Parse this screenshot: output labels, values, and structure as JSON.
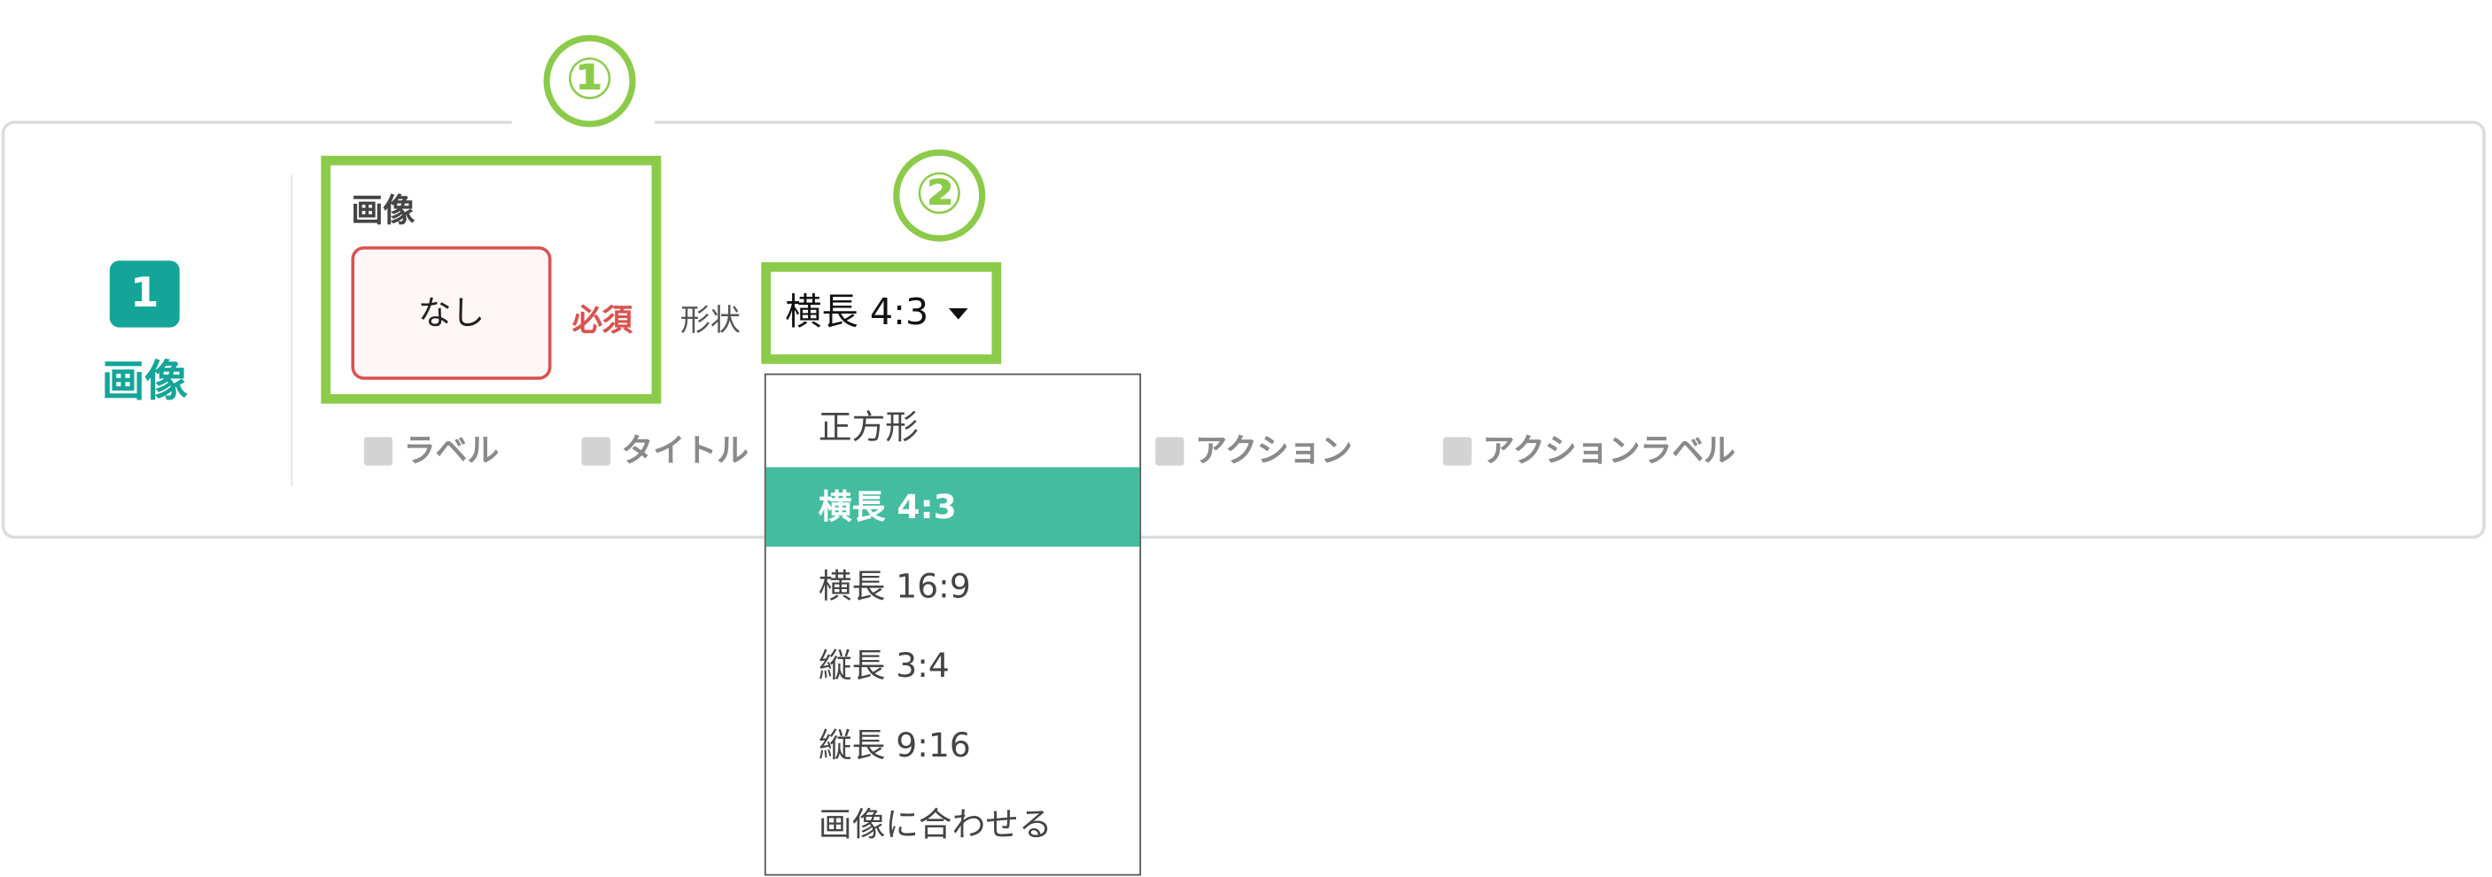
{
  "callouts": {
    "one": "①",
    "two": "②"
  },
  "step": {
    "number": "1",
    "label": "画像"
  },
  "image_field": {
    "title": "画像",
    "placeholder": "なし",
    "required": "必須"
  },
  "shape": {
    "label": "形状",
    "selected": "横長 4:3",
    "options": [
      "正方形",
      "横長 4:3",
      "横長 16:9",
      "縦長 3:4",
      "縦長 9:16",
      "画像に合わせる"
    ]
  },
  "toggles": [
    "ラベル",
    "タイトル",
    "アクション",
    "アクションラベル"
  ],
  "colors": {
    "accent": "#14a598",
    "highlight": "#8ccb4a",
    "required": "#d9534f",
    "selected_bg": "#43bc9f"
  }
}
